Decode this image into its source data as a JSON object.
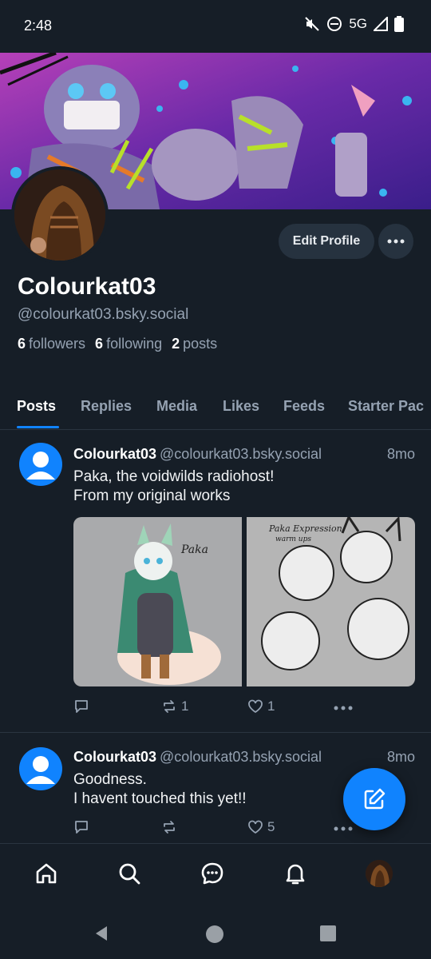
{
  "status_bar": {
    "time": "2:48",
    "network": "5G",
    "icons": [
      "mute-icon",
      "dnd-icon",
      "signal-icon",
      "battery-icon"
    ]
  },
  "profile": {
    "display_name": "Colourkat03",
    "handle": "@colourkat03.bsky.social",
    "stats": {
      "followers_count": "6",
      "followers_label": "followers",
      "following_count": "6",
      "following_label": "following",
      "posts_count": "2",
      "posts_label": "posts"
    },
    "edit_button": "Edit Profile",
    "more_icon": "more-horizontal-icon"
  },
  "tabs": [
    {
      "label": "Posts",
      "active": true
    },
    {
      "label": "Replies"
    },
    {
      "label": "Media"
    },
    {
      "label": "Likes"
    },
    {
      "label": "Feeds"
    },
    {
      "label": "Starter Pac"
    }
  ],
  "posts": [
    {
      "author": "Colourkat03",
      "handle": "@colourkat03.bsky.social",
      "time": "8mo",
      "text": "Paka, the voidwilds radiohost!\nFrom my original works",
      "images": [
        "Paka character drawing",
        "Paka Expression warm ups sketch"
      ],
      "image_text": {
        "left": "Paka",
        "right_title": "Paka Expression",
        "right_subtitle": "warm ups"
      },
      "reply_count": "",
      "repost_count": "1",
      "like_count": "1"
    },
    {
      "author": "Colourkat03",
      "handle": "@colourkat03.bsky.social",
      "time": "8mo",
      "text": "Goodness.\nI havent touched this yet!!",
      "reply_count": "",
      "repost_count": "",
      "like_count": "5"
    }
  ],
  "bottom_nav": [
    "home-icon",
    "search-icon",
    "chat-icon",
    "notifications-icon",
    "profile-avatar"
  ],
  "colors": {
    "background": "#161e27",
    "accent": "#1083fe",
    "muted": "#95a2b2",
    "button": "#26323f"
  }
}
